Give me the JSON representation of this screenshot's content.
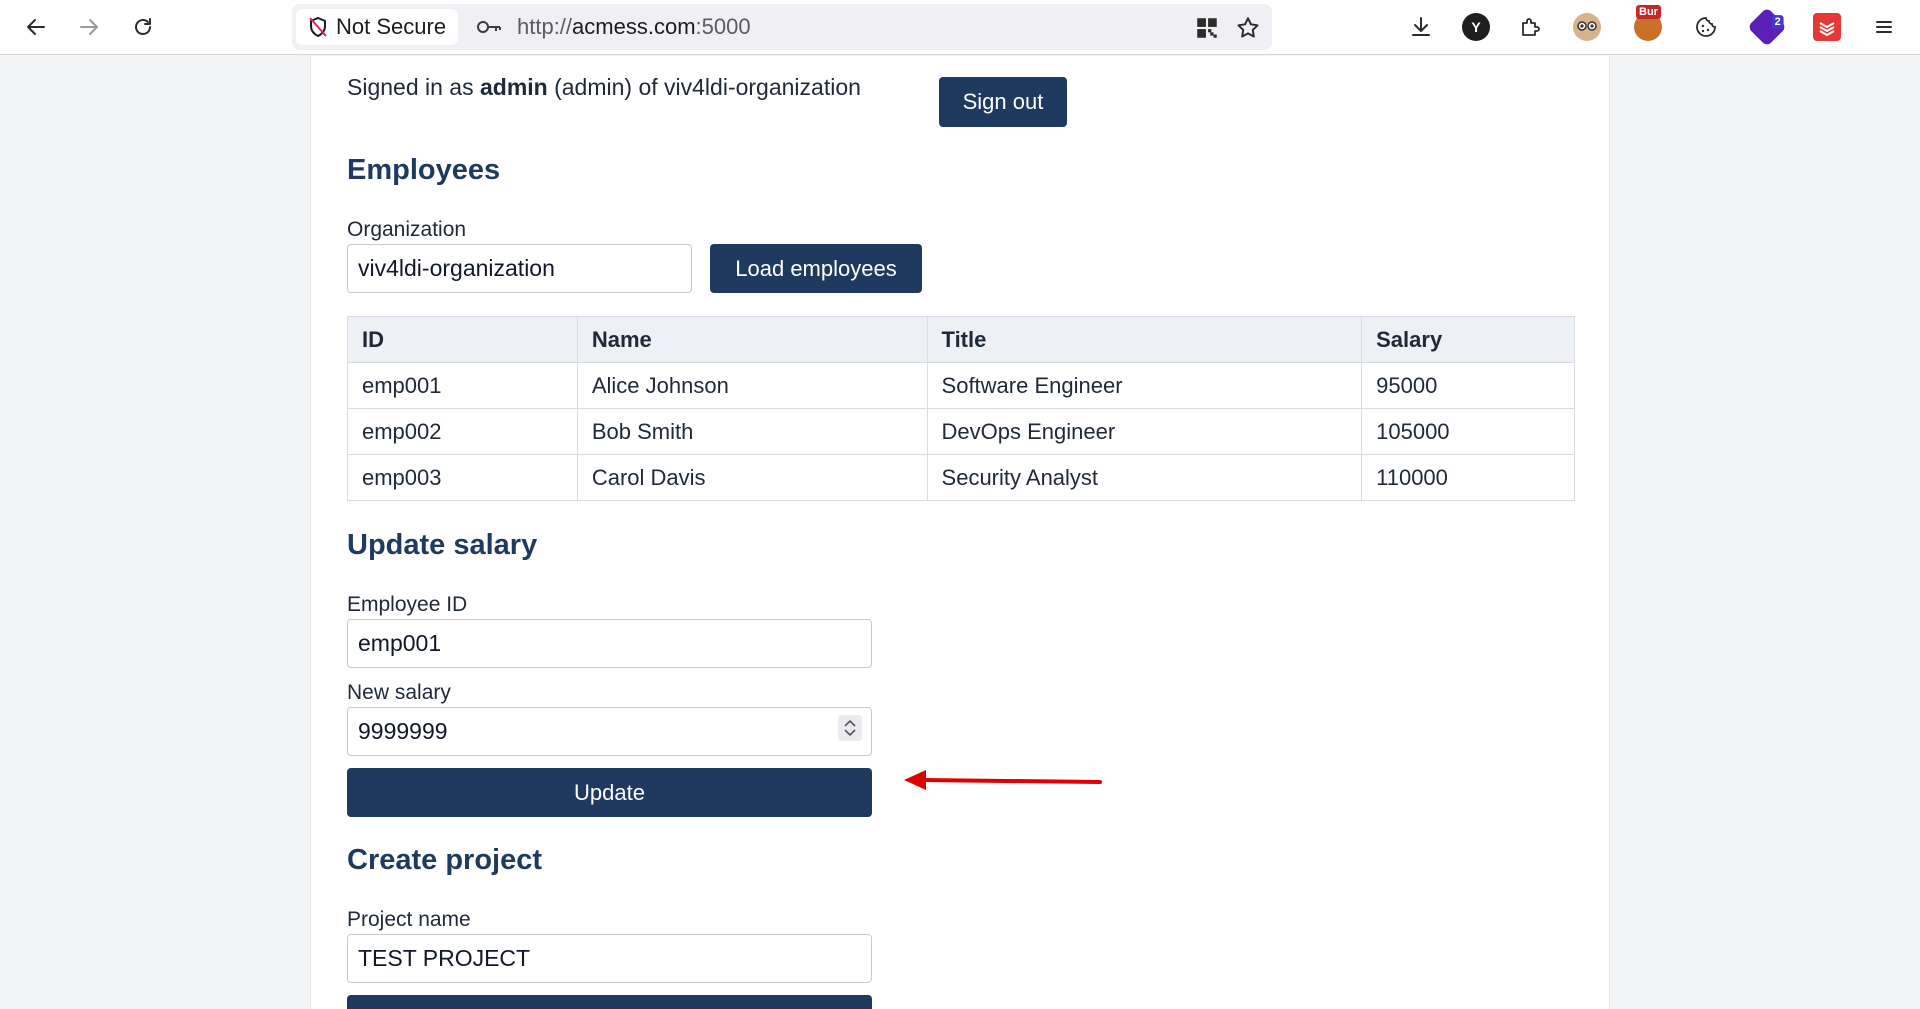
{
  "browser": {
    "security_label": "Not Secure",
    "url_prefix": "http://",
    "url_host": "acmess.com",
    "url_port": ":5000",
    "ext_bur_badge": "Bur",
    "ext_counter_badge": "2",
    "ext_y_letter": "Y"
  },
  "header": {
    "signed_in_prefix": "Signed in as ",
    "username": "admin",
    "signed_in_suffix": " (admin) of viv4ldi-organization",
    "sign_out_label": "Sign out"
  },
  "employees": {
    "heading": "Employees",
    "org_label": "Organization",
    "org_value": "viv4ldi-organization",
    "load_label": "Load employees",
    "columns": [
      "ID",
      "Name",
      "Title",
      "Salary"
    ],
    "rows": [
      [
        "emp001",
        "Alice Johnson",
        "Software Engineer",
        "95000"
      ],
      [
        "emp002",
        "Bob Smith",
        "DevOps Engineer",
        "105000"
      ],
      [
        "emp003",
        "Carol Davis",
        "Security Analyst",
        "110000"
      ]
    ]
  },
  "update_salary": {
    "heading": "Update salary",
    "employee_id_label": "Employee ID",
    "employee_id_value": "emp001",
    "new_salary_label": "New salary",
    "new_salary_value": "9999999",
    "update_label": "Update"
  },
  "create_project": {
    "heading": "Create project",
    "project_name_label": "Project name",
    "project_name_value": "TEST PROJECT"
  },
  "colors": {
    "accent": "#1e3a5f",
    "annotation_arrow": "#e00000"
  }
}
